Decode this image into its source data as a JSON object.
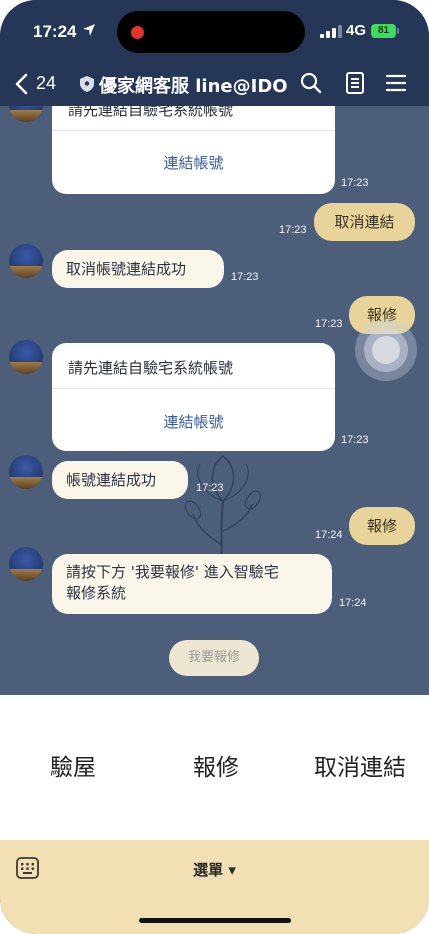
{
  "status": {
    "time": "17:24",
    "network": "4G",
    "battery": "81"
  },
  "header": {
    "back_count": "24",
    "title": "優家網客服 line@IDO"
  },
  "messages": {
    "card1": {
      "text": "請先連結自驗宅系統帳號",
      "link": "連結帳號",
      "time": "17:23"
    },
    "out1": {
      "text": "取消連結",
      "time": "17:23"
    },
    "in1": {
      "text": "取消帳號連結成功",
      "time": "17:23"
    },
    "out2": {
      "text": "報修",
      "time": "17:23"
    },
    "card2": {
      "text": "請先連結自驗宅系統帳號",
      "link": "連結帳號",
      "time": "17:23"
    },
    "in2": {
      "text": "帳號連結成功",
      "time": "17:23"
    },
    "out3": {
      "text": "報修",
      "time": "17:24"
    },
    "in3": {
      "line1": "請按下方 '我要報修' 進入智驗宅",
      "line2": "報修系統",
      "time": "17:24"
    }
  },
  "quick_reply": "我要報修",
  "rich_menu": {
    "item1": "驗屋",
    "item2": "報修",
    "item3": "取消連結"
  },
  "bottom": {
    "menu_label": "選單 ▾"
  },
  "colors": {
    "header_bg": "#253656",
    "chat_bg": "#4d5e7b",
    "outgoing": "#e8d49a",
    "incoming": "#fbf6ea",
    "bottom_bar": "#f2dfb3"
  }
}
